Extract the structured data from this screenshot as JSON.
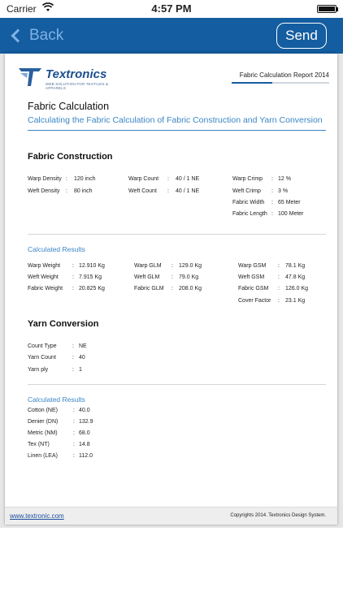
{
  "status": {
    "carrier": "Carrier",
    "time": "4:57 PM"
  },
  "nav": {
    "back_label": "Back",
    "send_label": "Send"
  },
  "logo": {
    "name": "Textronics",
    "tagline": "WEB SOLUTION FOR TEXTILES & APPARELS"
  },
  "report_title": "Fabric Calculation Report 2014",
  "calc_title": "Fabric Calculation",
  "calc_subtitle": "Calculating the Fabric Calculation of Fabric Construction and Yarn Conversion",
  "fabric_construction": {
    "heading": "Fabric Construction",
    "col1": [
      {
        "label": "Warp Density",
        "value": "120 inch"
      },
      {
        "label": "Weft Density",
        "value": "80 inch"
      }
    ],
    "col2": [
      {
        "label": "Warp Count",
        "value": "40 / 1 NE"
      },
      {
        "label": "Weft Count",
        "value": "40 / 1 NE"
      }
    ],
    "col3": [
      {
        "label": "Warp Crimp",
        "value": "12 %"
      },
      {
        "label": "Weft Crimp",
        "value": "3 %"
      },
      {
        "label": "Fabric Width",
        "value": "65 Meter"
      },
      {
        "label": "Fabric Length",
        "value": "100 Meter"
      }
    ]
  },
  "fabric_results": {
    "heading": "Calculated Results",
    "col1": [
      {
        "label": "Warp Weight",
        "value": "12.910 Kg"
      },
      {
        "label": "Weft Weight",
        "value": "7.915 Kg"
      },
      {
        "label": "Fabric Weight",
        "value": "20.825 Kg"
      }
    ],
    "col2": [
      {
        "label": "Warp GLM",
        "value": "129.0 Kg"
      },
      {
        "label": "Weft GLM",
        "value": "79.0 Kg"
      },
      {
        "label": "Fabric GLM",
        "value": "208.0 Kg"
      }
    ],
    "col3": [
      {
        "label": "Warp GSM",
        "value": "78.1 Kg"
      },
      {
        "label": "Weft GSM",
        "value": "47.8 Kg"
      },
      {
        "label": "Fabric GSM",
        "value": "126.0 Kg"
      },
      {
        "label": "Cover Factor",
        "value": "23.1 Kg"
      }
    ]
  },
  "yarn_conversion": {
    "heading": "Yarn Conversion",
    "rows": [
      {
        "label": "Count Type",
        "value": "NE"
      },
      {
        "label": "Yarn Count",
        "value": "40"
      },
      {
        "label": "Yarn ply",
        "value": "1"
      }
    ]
  },
  "yarn_results": {
    "heading": "Calculated Results",
    "rows": [
      {
        "label": "Cotton  (NE)",
        "value": "40.0"
      },
      {
        "label": "Denier  (DN)",
        "value": "132.9"
      },
      {
        "label": "Metric  (NM)",
        "value": "68.0"
      },
      {
        "label": "Tex      (NT)",
        "value": "14.8"
      },
      {
        "label": "Linen  (LEA)",
        "value": "112.0"
      }
    ]
  },
  "footer": {
    "link": "www.textronic.com",
    "copyright": "Copyrights 2014. Textronics Design System."
  }
}
